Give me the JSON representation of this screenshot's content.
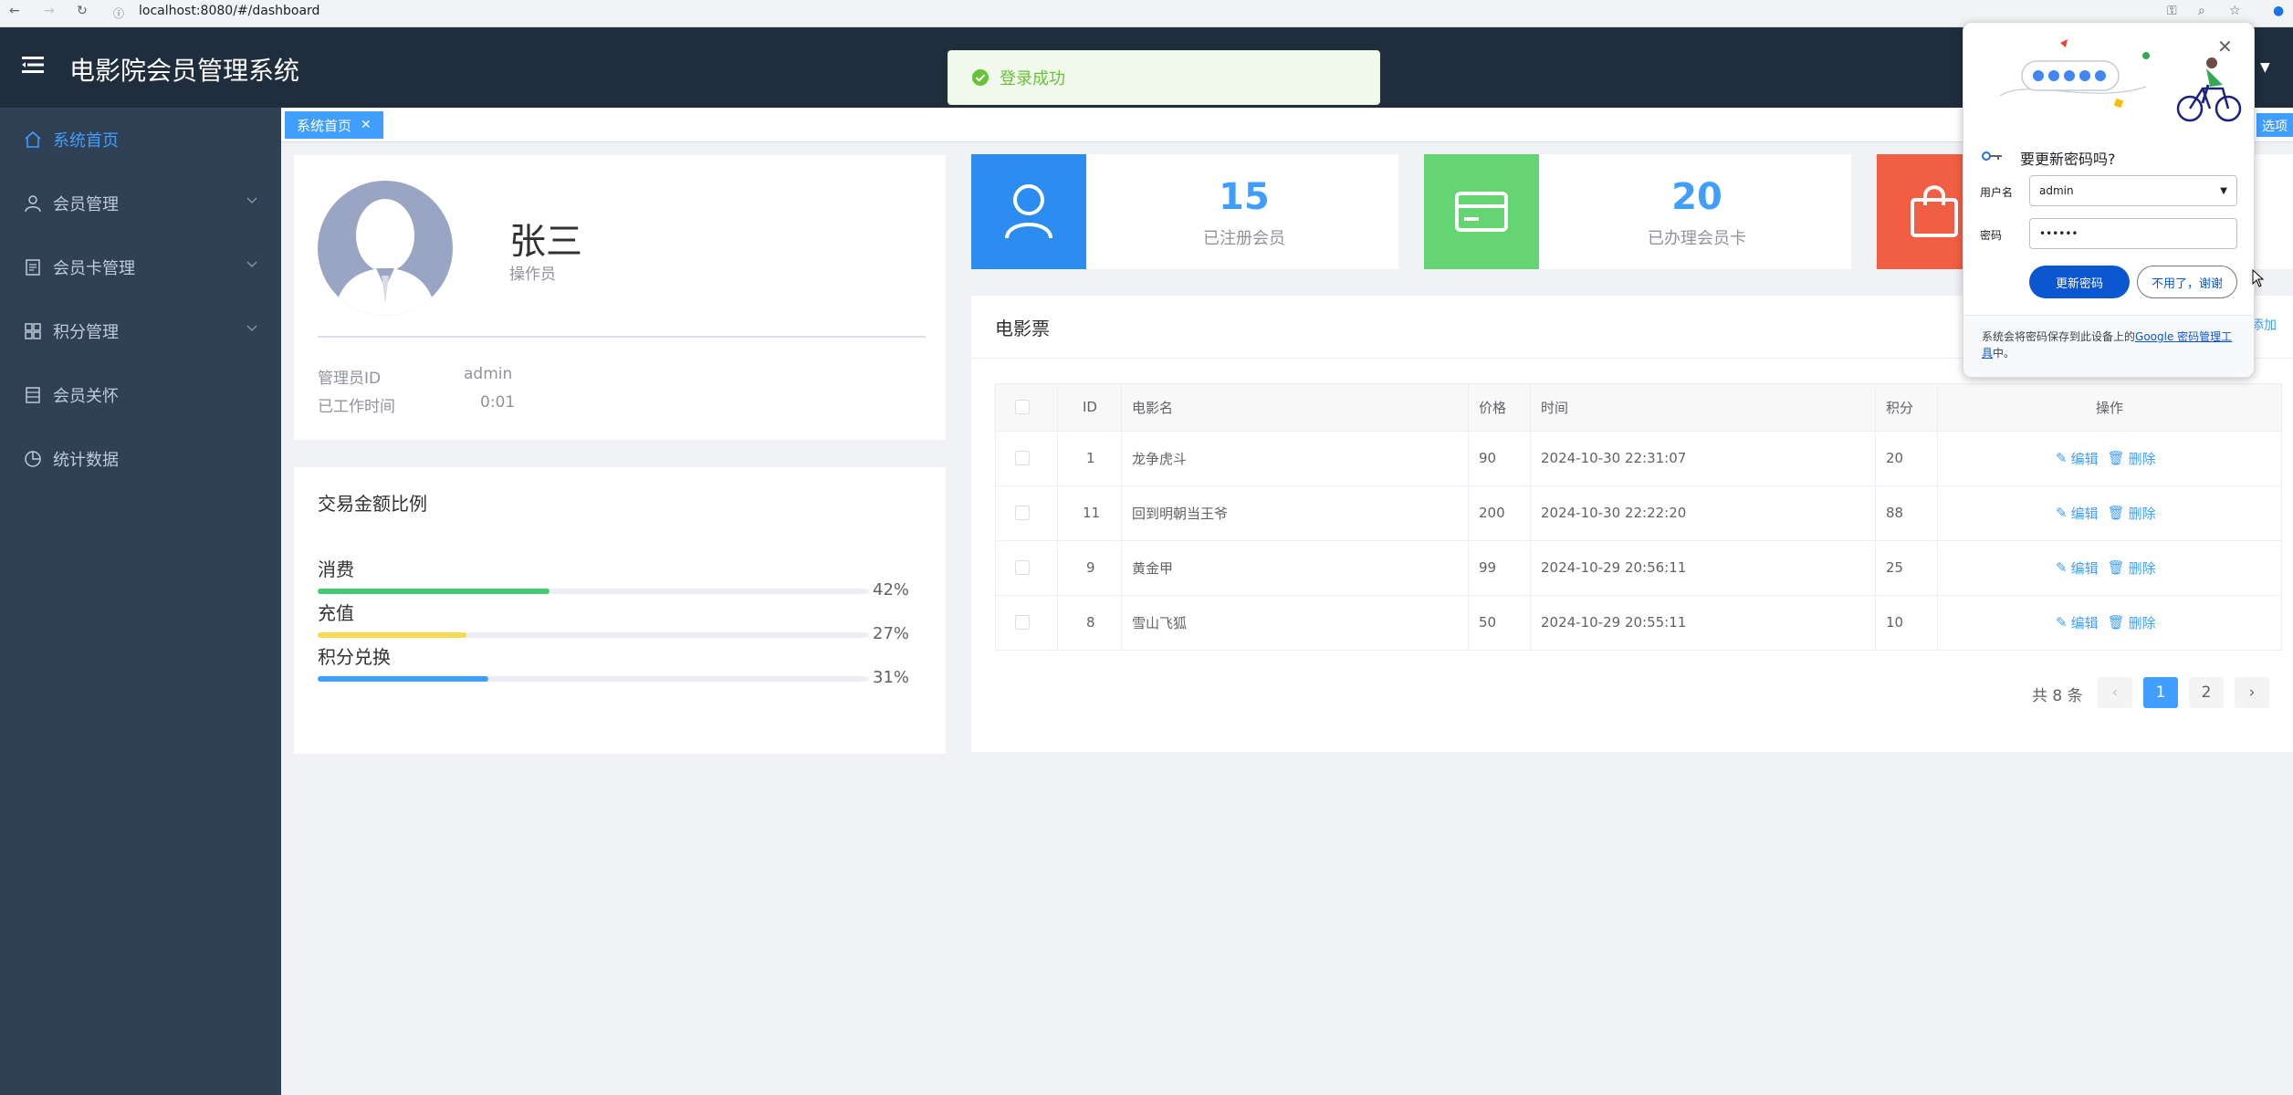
{
  "browser": {
    "url": "localhost:8080/#/dashboard"
  },
  "header": {
    "title": "电影院会员管理系统"
  },
  "sidebar": {
    "items": [
      {
        "label": "系统首页",
        "icon": "home-icon",
        "active": true
      },
      {
        "label": "会员管理",
        "icon": "user-icon",
        "expandable": true
      },
      {
        "label": "会员卡管理",
        "icon": "document-icon",
        "expandable": true
      },
      {
        "label": "积分管理",
        "icon": "grid-icon",
        "expandable": true
      },
      {
        "label": "会员关怀",
        "icon": "list-icon"
      },
      {
        "label": "统计数据",
        "icon": "pie-chart-icon"
      }
    ]
  },
  "tags": {
    "current": "系统首页",
    "close_others": "选项"
  },
  "toast": {
    "message": "登录成功",
    "icon": "success-check-icon"
  },
  "user_card": {
    "name": "张三",
    "role": "操作员",
    "admin_id_label": "管理员ID",
    "admin_id_value": "admin",
    "work_time_label": "已工作时间",
    "work_time_value": "0:01"
  },
  "transaction_card": {
    "title": "交易金额比例",
    "items": [
      {
        "label": "消费",
        "percent": 42,
        "percent_text": "42%",
        "color": "#48c774"
      },
      {
        "label": "充值",
        "percent": 27,
        "percent_text": "27%",
        "color": "#f2dc4c"
      },
      {
        "label": "积分兑换",
        "percent": 31,
        "percent_text": "31%",
        "color": "#409eff"
      }
    ]
  },
  "stats": [
    {
      "value": "15",
      "label": "已注册会员",
      "color": "#2d8cf0",
      "icon": "user-outline-icon"
    },
    {
      "value": "20",
      "label": "已办理会员卡",
      "color": "#64d572",
      "icon": "card-icon"
    },
    {
      "value": "",
      "label": "",
      "color": "#f25e43",
      "icon": "shopping-bag-icon"
    }
  ],
  "movie_table": {
    "title": "电影票",
    "add_label": "添加",
    "columns": [
      "ID",
      "电影名",
      "价格",
      "时间",
      "积分",
      "操作"
    ],
    "rows": [
      {
        "id": "1",
        "name": "龙争虎斗",
        "price": "90",
        "time": "2024-10-30 22:31:07",
        "points": "20"
      },
      {
        "id": "11",
        "name": "回到明朝当王爷",
        "price": "200",
        "time": "2024-10-30 22:22:20",
        "points": "88"
      },
      {
        "id": "9",
        "name": "黄金甲",
        "price": "99",
        "time": "2024-10-29 20:56:11",
        "points": "25"
      },
      {
        "id": "8",
        "name": "雪山飞狐",
        "price": "50",
        "time": "2024-10-29 20:55:11",
        "points": "10"
      }
    ],
    "edit_label": "编辑",
    "delete_label": "删除",
    "total_text": "共 8 条",
    "pages": [
      "1",
      "2"
    ],
    "current_page": "1"
  },
  "password_popup": {
    "title": "要更新密码吗?",
    "username_label": "用户名",
    "username_value": "admin",
    "password_label": "密码",
    "password_value": "••••••",
    "update_button": "更新密码",
    "decline_button": "不用了，谢谢",
    "footer_text": "系统会将密码保存到此设备上的",
    "footer_link": "Google 密码管理工具",
    "footer_suffix": "中。"
  }
}
